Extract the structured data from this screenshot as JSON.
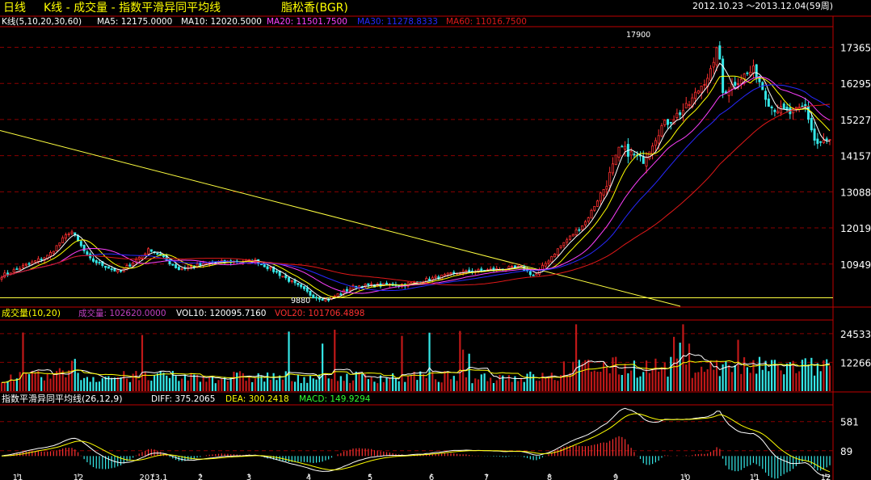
{
  "title_bar": {
    "period": "日线",
    "chart_name": "K线 - 成交量 - 指数平滑异同平均线",
    "instrument": "脂松香(BGR)",
    "date_range": "2012.10.23 ～2013.12.04(59周)"
  },
  "colors": {
    "background": "#000000",
    "up_candle": "#ff3030",
    "down_candle": "#35e8e8",
    "ma5": "#ffffff",
    "ma10": "#ffff00",
    "ma20": "#ff40ff",
    "ma30": "#2828ff",
    "ma60": "#e01818",
    "grid": "#8a0000",
    "panel_border": "#c00000",
    "axis_text": "#ffffff",
    "trendline": "#ffff40",
    "diff": "#ffffff",
    "dea": "#ffff00",
    "macd_pos": "#ff3030",
    "macd_neg": "#35e8e8"
  },
  "price_panel": {
    "indicator_label": "K线(5,10,20,30,60)",
    "legend": [
      {
        "label": "MA5: 12175.0000",
        "color": "#ffffff"
      },
      {
        "label": "MA10: 12020.5000",
        "color": "#ffffff"
      },
      {
        "label": "MA20: 11501.7500",
        "color": "#ff40ff"
      },
      {
        "label": "MA30: 11278.8333",
        "color": "#2828ff"
      },
      {
        "label": "MA60: 11016.7500",
        "color": "#e01818"
      }
    ],
    "y_ticks": [
      "17365",
      "16295",
      "15227",
      "14157",
      "13088",
      "12019",
      "10949"
    ],
    "y_tick_values": [
      17365,
      16295,
      15227,
      14157,
      13088,
      12019,
      10949
    ],
    "high_label": "17900",
    "low_label": "9880"
  },
  "volume_panel": {
    "indicator_label": "成交量(10,20)",
    "legend": [
      {
        "label": "成交量: 102620.0000",
        "color": "#c040c0"
      },
      {
        "label": "VOL10: 120095.7160",
        "color": "#ffffff"
      },
      {
        "label": "VOL20: 101706.4898",
        "color": "#ff3030"
      }
    ],
    "y_ticks": [
      "24533",
      "12266"
    ]
  },
  "macd_panel": {
    "indicator_label": "指数平滑异同平均线(26,12,9)",
    "legend": [
      {
        "label": "DIFF: 375.2065",
        "color": "#ffffff"
      },
      {
        "label": "DEA: 300.2418",
        "color": "#ffff00"
      },
      {
        "label": "MACD: 149.9294",
        "color": "#30ff30"
      }
    ],
    "y_ticks": [
      "581",
      "89"
    ]
  },
  "x_axis": {
    "labels": [
      "11",
      "12",
      "2013.1",
      "2",
      "3",
      "4",
      "5",
      "6",
      "7",
      "8",
      "9",
      "10",
      "11",
      "12"
    ]
  },
  "chart_data": {
    "type": "candlestick",
    "period": "daily",
    "x_range": [
      "2012.10.23",
      "2013.12.04"
    ],
    "price_ylim": [
      9700,
      17950
    ],
    "price_high": 17900,
    "price_low": 9880,
    "price_path_keypoints": [
      [
        "2012.10.23",
        10600
      ],
      [
        "2012.11.15",
        11200
      ],
      [
        "2012.11.26",
        11950
      ],
      [
        "2012.12.05",
        11100
      ],
      [
        "2012.12.20",
        10700
      ],
      [
        "2013.01.04",
        11400
      ],
      [
        "2013.01.18",
        10800
      ],
      [
        "2013.02.05",
        11000
      ],
      [
        "2013.02.25",
        11050
      ],
      [
        "2013.03.10",
        10600
      ],
      [
        "2013.03.25",
        10000
      ],
      [
        "2013.04.01",
        9900
      ],
      [
        "2013.04.15",
        10300
      ],
      [
        "2013.05.10",
        10350
      ],
      [
        "2013.06.05",
        10700
      ],
      [
        "2013.07.05",
        10850
      ],
      [
        "2013.07.12",
        10600
      ],
      [
        "2013.07.25",
        11500
      ],
      [
        "2013.08.06",
        12200
      ],
      [
        "2013.08.16",
        13300
      ],
      [
        "2013.08.23",
        14400
      ],
      [
        "2013.09.03",
        14000
      ],
      [
        "2013.09.12",
        15000
      ],
      [
        "2013.09.25",
        15600
      ],
      [
        "2013.10.08",
        16800
      ],
      [
        "2013.10.10",
        17700
      ],
      [
        "2013.10.12",
        16000
      ],
      [
        "2013.10.22",
        16500
      ],
      [
        "2013.10.28",
        16700
      ],
      [
        "2013.11.05",
        15600
      ],
      [
        "2013.11.15",
        15400
      ],
      [
        "2013.11.22",
        15600
      ],
      [
        "2013.11.27",
        14500
      ],
      [
        "2013.12.04",
        14600
      ]
    ],
    "volume_ylim": [
      0,
      30000
    ],
    "volume_levels": {
      "typical": 6000,
      "high": 24533,
      "mid": 12266
    },
    "macd_ylim": [
      -350,
      850
    ],
    "macd_ticks": [
      581,
      89
    ],
    "last_values": {
      "MA5": 12175.0,
      "MA10": 12020.5,
      "MA20": 11501.75,
      "MA30": 11278.8333,
      "MA60": 11016.75,
      "VOL": 102620.0,
      "VOL10": 120095.716,
      "VOL20": 101706.4898,
      "DIFF": 375.2065,
      "DEA": 300.2418,
      "MACD": 149.9294
    }
  }
}
